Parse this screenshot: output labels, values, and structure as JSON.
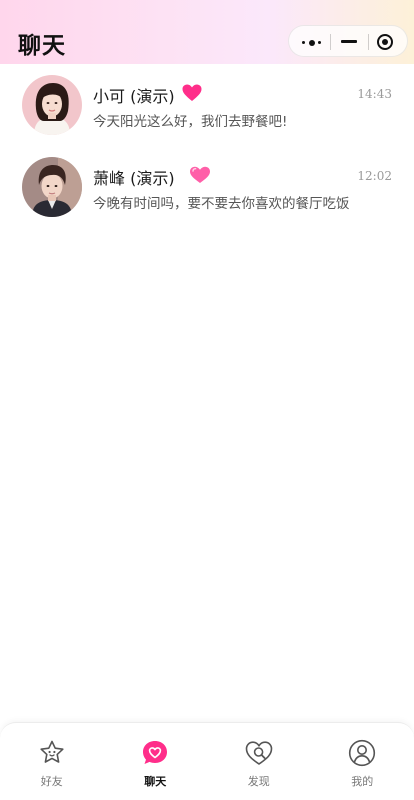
{
  "header": {
    "title": "聊天",
    "capsule": {
      "more_icon": "more-dots-icon",
      "minimize_icon": "minimize-icon",
      "close_icon": "target-icon"
    }
  },
  "colors": {
    "accent_pink": "#ff2e8a",
    "heart_light": "#ff5fa8",
    "header_gradient": [
      "#ffd6ec",
      "#fdf1d8"
    ]
  },
  "chats": [
    {
      "name": "小可 (演示)",
      "time": "14:43",
      "preview": "今天阳光这么好，我们去野餐吧!",
      "heart_icon": "heart-icon"
    },
    {
      "name": "萧峰 (演示)",
      "time": "12:02",
      "preview": "今晚有时间吗，要不要去你喜欢的餐厅吃饭",
      "heart_icon": "heart-icon"
    }
  ],
  "tabs": [
    {
      "label": "好友",
      "icon": "star-face-icon",
      "active": false
    },
    {
      "label": "聊天",
      "icon": "chat-heart-icon",
      "active": true
    },
    {
      "label": "发现",
      "icon": "heart-search-icon",
      "active": false
    },
    {
      "label": "我的",
      "icon": "user-icon",
      "active": false
    }
  ]
}
